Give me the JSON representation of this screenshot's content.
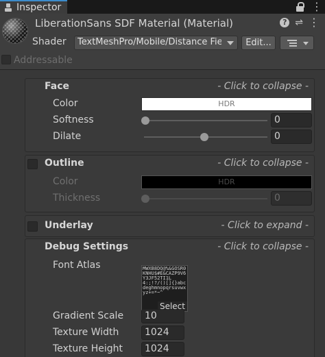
{
  "window": {
    "tab_title": "Inspector"
  },
  "header": {
    "material_title": "LiberationSans SDF Material (Material)",
    "shader_label": "Shader",
    "shader_value": "TextMeshPro/Mobile/Distance Field",
    "edit_button": "Edit...",
    "addressable_label": "Addressable"
  },
  "sections": {
    "face": {
      "title": "Face",
      "collapse_hint": "- Click to collapse -",
      "color_label": "Color",
      "color_hdr": "HDR",
      "softness_label": "Softness",
      "softness_value": "0",
      "softness_level": 0,
      "dilate_label": "Dilate",
      "dilate_value": "0",
      "dilate_level": 0.5
    },
    "outline": {
      "title": "Outline",
      "collapse_hint": "- Click to collapse -",
      "color_label": "Color",
      "color_hdr": "HDR",
      "thickness_label": "Thickness",
      "thickness_value": "0",
      "thickness_level": 0
    },
    "underlay": {
      "title": "Underlay",
      "expand_hint": "- Click to expand -"
    },
    "debug": {
      "title": "Debug Settings",
      "collapse_hint": "- Click to collapse -",
      "font_atlas_label": "Font Atlas",
      "select_label": "Select",
      "gradient_scale_label": "Gradient Scale",
      "gradient_scale_value": "10",
      "texture_width_label": "Texture Width",
      "texture_width_value": "1024",
      "texture_height_label": "Texture Height",
      "texture_height_value": "1024"
    }
  },
  "colors": {
    "face_color": "#ffffff",
    "outline_color": "#000000",
    "tab_accent": "#3c8ccc"
  }
}
